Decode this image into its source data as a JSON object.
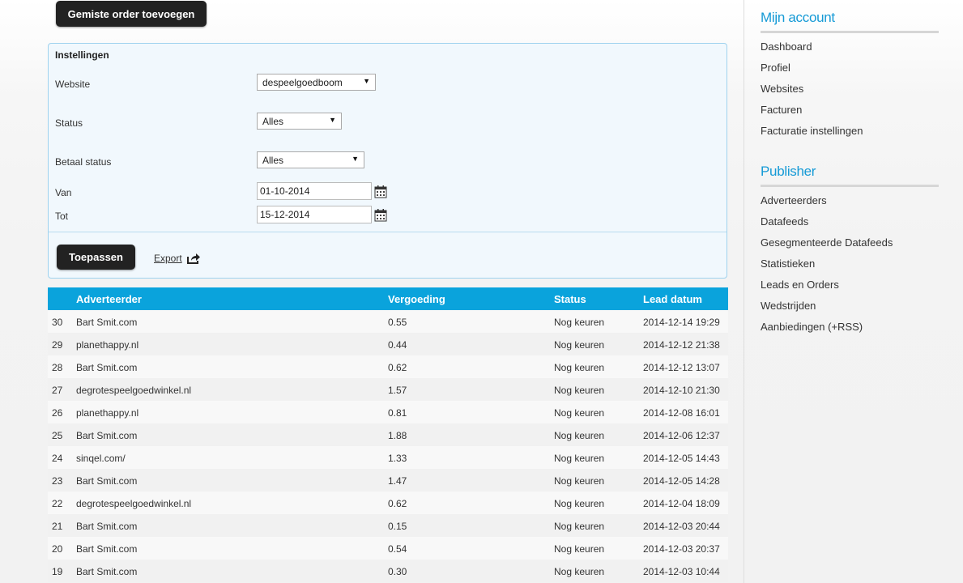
{
  "toolbar": {
    "add_order_label": "Gemiste order toevoegen"
  },
  "settings": {
    "title": "Instellingen",
    "website_label": "Website",
    "website_value": "despeelgoedboom",
    "status_label": "Status",
    "status_value": "Alles",
    "pay_status_label": "Betaal status",
    "pay_status_value": "Alles",
    "from_label": "Van",
    "from_value": "01-10-2014",
    "to_label": "Tot",
    "to_value": "15-12-2014",
    "apply_label": "Toepassen",
    "export_label": "Export",
    "icons": {
      "calendar": "calendar-icon",
      "export": "export-arrow-icon",
      "dropdown": "chevron-down-icon"
    }
  },
  "table": {
    "headers": [
      "",
      "Adverteerder",
      "Vergoeding",
      "Status",
      "Lead datum"
    ],
    "rows": [
      [
        "30",
        "Bart Smit.com",
        "0.55",
        "Nog keuren",
        "2014-12-14 19:29"
      ],
      [
        "29",
        "planethappy.nl",
        "0.44",
        "Nog keuren",
        "2014-12-12 21:38"
      ],
      [
        "28",
        "Bart Smit.com",
        "0.62",
        "Nog keuren",
        "2014-12-12 13:07"
      ],
      [
        "27",
        "degrotespeelgoedwinkel.nl",
        "1.57",
        "Nog keuren",
        "2014-12-10 21:30"
      ],
      [
        "26",
        "planethappy.nl",
        "0.81",
        "Nog keuren",
        "2014-12-08 16:01"
      ],
      [
        "25",
        "Bart Smit.com",
        "1.88",
        "Nog keuren",
        "2014-12-06 12:37"
      ],
      [
        "24",
        "sinqel.com/",
        "1.33",
        "Nog keuren",
        "2014-12-05 14:43"
      ],
      [
        "23",
        "Bart Smit.com",
        "1.47",
        "Nog keuren",
        "2014-12-05 14:28"
      ],
      [
        "22",
        "degrotespeelgoedwinkel.nl",
        "0.62",
        "Nog keuren",
        "2014-12-04 18:09"
      ],
      [
        "21",
        "Bart Smit.com",
        "0.15",
        "Nog keuren",
        "2014-12-03 20:44"
      ],
      [
        "20",
        "Bart Smit.com",
        "0.54",
        "Nog keuren",
        "2014-12-03 20:37"
      ],
      [
        "19",
        "Bart Smit.com",
        "0.30",
        "Nog keuren",
        "2014-12-03 10:44"
      ]
    ]
  },
  "sidebar": {
    "account_heading": "Mijn account",
    "account_links": [
      "Dashboard",
      "Profiel",
      "Websites",
      "Facturen",
      "Facturatie instellingen"
    ],
    "publisher_heading": "Publisher",
    "publisher_links": [
      "Adverteerders",
      "Datafeeds",
      "Gesegmenteerde Datafeeds",
      "Statistieken",
      "Leads en Orders",
      "Wedstrijden",
      "Aanbiedingen (+RSS)"
    ]
  },
  "colors": {
    "accent": "#0aa3dc",
    "heading": "#159ad6",
    "button": "#222222",
    "panel_border": "#9fd2ee"
  }
}
